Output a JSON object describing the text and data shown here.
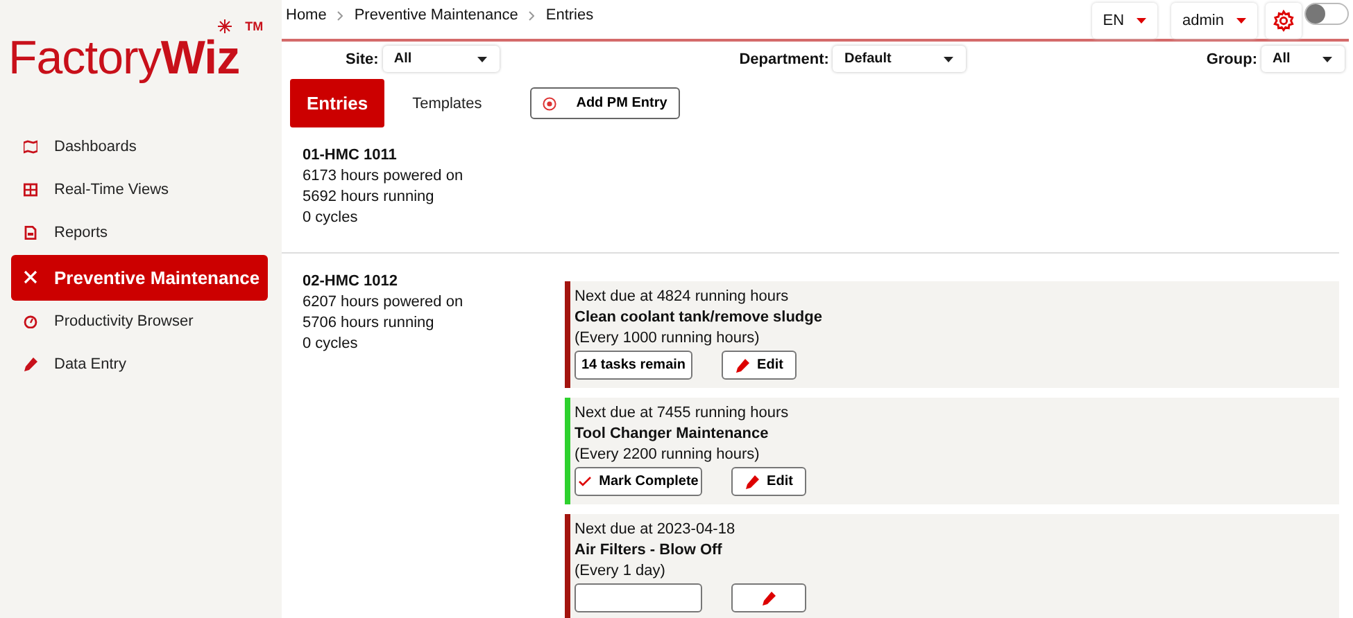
{
  "brand": {
    "name": "Factory",
    "accent": "Wiz",
    "mark": "TM"
  },
  "nav": [
    {
      "label": "Dashboards",
      "selected": false
    },
    {
      "label": "Real-Time Views",
      "selected": false
    },
    {
      "label": "Reports",
      "selected": false
    },
    {
      "label": "Preventive Maintenance",
      "selected": true
    },
    {
      "label": "Productivity Browser",
      "selected": false
    },
    {
      "label": "Data Entry",
      "selected": false
    }
  ],
  "breadcrumb": [
    "Home",
    "Preventive Maintenance",
    "Entries"
  ],
  "header": {
    "language": "EN",
    "user": "admin",
    "toggle_on": false
  },
  "filters": [
    {
      "label": "Site:",
      "value": "All"
    },
    {
      "label": "Department:",
      "value": "Default"
    },
    {
      "label": "Group:",
      "value": "All"
    }
  ],
  "tabs": [
    {
      "label": "Entries",
      "selected": true
    },
    {
      "label": "Templates",
      "selected": false
    }
  ],
  "add_button": "Add PM Entry",
  "machines": [
    {
      "name": "01-HMC 1011",
      "stats": [
        "6173 hours powered on",
        "5692 hours running",
        "0 cycles"
      ]
    },
    {
      "name": "02-HMC 1012",
      "stats": [
        "6207 hours powered on",
        "5706 hours running",
        "0 cycles"
      ],
      "tasks": [
        {
          "color": "#a3150f",
          "due": "Next due at 4824 running hours",
          "title": "Clean coolant tank/remove sludge",
          "interval": "(Every 1000 running hours)",
          "action": {
            "kind": "remaining",
            "label": "14 tasks remain"
          },
          "edit": "Edit"
        },
        {
          "color": "#2ed12e",
          "due": "Next due at 7455 running hours",
          "title": "Tool Changer Maintenance",
          "interval": "(Every 2200 running hours)",
          "action": {
            "kind": "complete",
            "label": "Mark Complete"
          },
          "edit": "Edit"
        },
        {
          "color": "#a3150f",
          "due": "Next due at 2023-04-18",
          "title": "Air Filters - Blow Off",
          "interval": "(Every 1 day)",
          "action": {
            "kind": "complete"
          }
        }
      ]
    }
  ]
}
